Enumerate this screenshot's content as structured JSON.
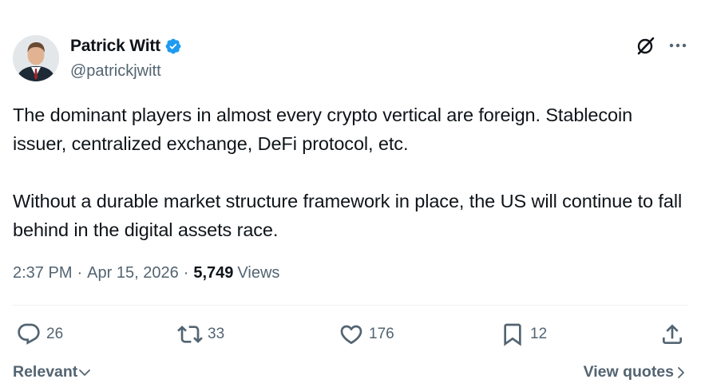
{
  "author": {
    "display_name": "Patrick Witt",
    "handle": "@patrickjwitt",
    "verified": true,
    "verified_color": "#1d9bf0"
  },
  "tweet": {
    "paragraphs": [
      "The dominant players in almost every crypto vertical are foreign. Stablecoin issuer, centralized exchange, DeFi protocol, etc.",
      "Without a durable market structure framework in place, the US will continue to fall behind in the digital assets race."
    ],
    "time": "2:37 PM",
    "date": "Apr 15, 2026",
    "views_count": "5,749",
    "views_label": "Views",
    "separator": "·"
  },
  "actions": {
    "replies": "26",
    "reposts": "33",
    "likes": "176",
    "bookmarks": "12"
  },
  "footer": {
    "sort_label": "Relevant",
    "quotes_label": "View quotes"
  },
  "icons": {
    "top": [
      "grok-icon",
      "more-icon"
    ],
    "actions": [
      "reply-icon",
      "repost-icon",
      "like-icon",
      "bookmark-icon",
      "share-icon"
    ]
  },
  "colors": {
    "text_primary": "#0f1419",
    "text_secondary": "#536471",
    "divider": "#eff3f4"
  }
}
